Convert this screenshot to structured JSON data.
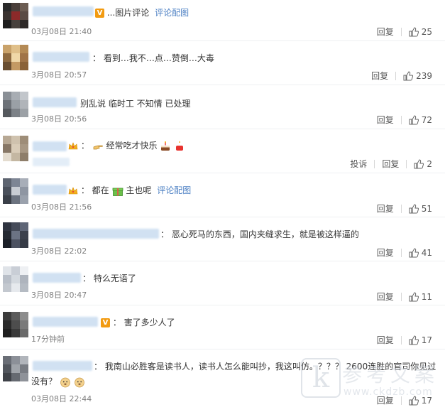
{
  "comments": [
    {
      "text": "...图片评论",
      "link": "评论配图",
      "time": "03月08日 21:40",
      "reply": "回复",
      "likes": "25"
    },
    {
      "text": "看到…我不…点…赞倒…大毒",
      "time": "3月08日 20:57",
      "reply": "回复",
      "likes": "239"
    },
    {
      "text": "别乱说 临时工 不知情 已处理",
      "time": "3月08日 20:56",
      "reply": "回复",
      "likes": "72"
    },
    {
      "text": "经常吃才快乐",
      "time": "",
      "report": "投诉",
      "reply": "回复",
      "likes": "2"
    },
    {
      "text": "都在",
      "text2": "主也呢",
      "link": "评论配图",
      "time": "03月08日 21:56",
      "reply": "回复",
      "likes": "51"
    },
    {
      "text": "恶心死马的东西，国内夹缝求生，就是被这样逼的",
      "time": "3月08日 22:02",
      "reply": "回复",
      "likes": "41"
    },
    {
      "text": "特么无语了",
      "time": "3月08日 20:47",
      "reply": "回复",
      "likes": "11"
    },
    {
      "text": "害了多少人了",
      "time": "17分钟前",
      "reply": "回复",
      "likes": "17"
    },
    {
      "text": "我南山必胜客是读书人，读书人怎么能叫抄，我这叫仿。？？？ 2600连胜的官司你见过",
      "text_line2": "没有？",
      "time": "03月08日 22:44",
      "reply": "回复",
      "likes": "17"
    }
  ],
  "watermark": {
    "letter": "k",
    "chinese": "参考文案",
    "url": "www.ckdzb.com"
  },
  "colors": {
    "link": "#4b7fc3",
    "time": "#808080",
    "badge": "#f29b12"
  }
}
